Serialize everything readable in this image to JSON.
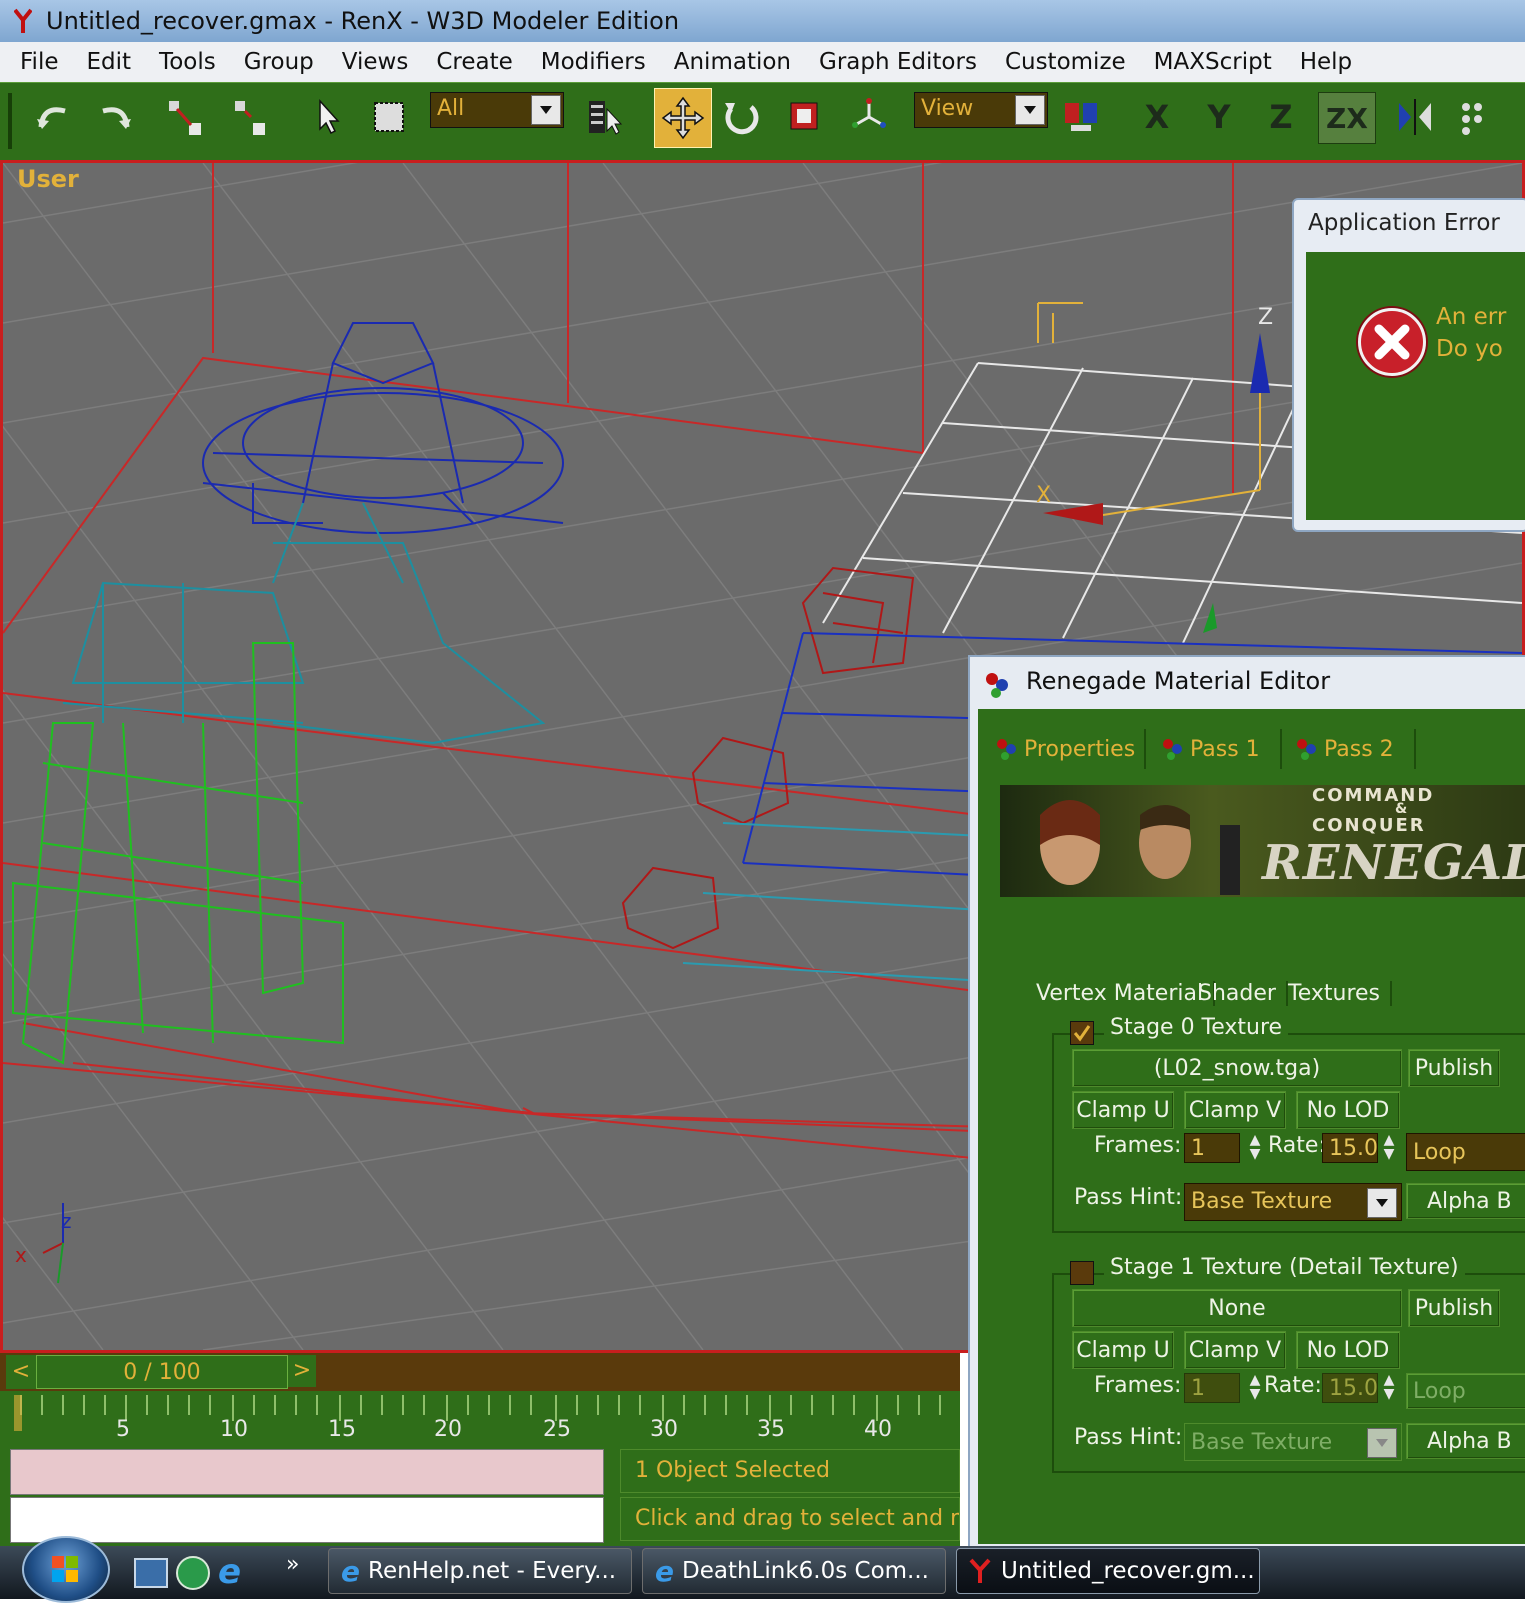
{
  "window": {
    "title": "Untitled_recover.gmax - RenX - W3D Modeler Edition"
  },
  "menu": [
    "File",
    "Edit",
    "Tools",
    "Group",
    "Views",
    "Create",
    "Modifiers",
    "Animation",
    "Graph Editors",
    "Customize",
    "MAXScript",
    "Help"
  ],
  "toolbar": {
    "selection_filter": "All",
    "coord_system": "View",
    "axes": [
      "X",
      "Y",
      "Z",
      "ZX"
    ]
  },
  "viewport": {
    "label": "User",
    "axis_labels": {
      "z": "z",
      "x": "x"
    },
    "gizmo_labels": {
      "z": "Z",
      "x": "X"
    }
  },
  "timeline": {
    "frame": "0 / 100",
    "prev": "<",
    "next": ">",
    "ticks": [
      "5",
      "10",
      "15",
      "20",
      "25",
      "30",
      "35",
      "40"
    ]
  },
  "status": {
    "selected": "1 Object Selected",
    "prompt": "Click and drag to select and move o"
  },
  "app_error": {
    "title": "Application Error",
    "line1": "An err",
    "line2": "Do yo"
  },
  "material_editor": {
    "title": "Renegade Material Editor",
    "tabs": [
      "Properties",
      "Pass 1",
      "Pass 2"
    ],
    "banner": {
      "line1": "COMMAND",
      "amp": "&",
      "line2": "CONQUER",
      "line3": "RENEGADE"
    },
    "subtabs": [
      "Vertex Material",
      "Shader",
      "Textures"
    ],
    "stage0": {
      "title": "Stage 0 Texture",
      "file": "(L02_snow.tga)",
      "publish": "Publish",
      "clamp_u": "Clamp U",
      "clamp_v": "Clamp V",
      "no_lod": "No LOD",
      "frames_label": "Frames:",
      "frames": "1",
      "rate_label": "Rate:",
      "rate": "15.0",
      "loop": "Loop",
      "pass_hint_label": "Pass Hint:",
      "pass_hint": "Base Texture",
      "alpha": "Alpha B"
    },
    "stage1": {
      "title": "Stage 1 Texture (Detail Texture)",
      "file": "None",
      "publish": "Publish",
      "clamp_u": "Clamp U",
      "clamp_v": "Clamp V",
      "no_lod": "No LOD",
      "frames_label": "Frames:",
      "frames": "1",
      "rate_label": "Rate:",
      "rate": "15.0",
      "loop": "Loop",
      "pass_hint_label": "Pass Hint:",
      "pass_hint": "Base Texture",
      "alpha": "Alpha B"
    }
  },
  "taskbar": {
    "chevron": "»",
    "items": [
      "RenHelp.net - Every...",
      "DeathLink6.0s Com...",
      "Untitled_recover.gm..."
    ]
  },
  "colors": {
    "green_ui": "#2f6e19",
    "viewport_bg": "#6b6b6b",
    "accent_orange": "#e2b13a",
    "error_red": "#c8202a"
  }
}
